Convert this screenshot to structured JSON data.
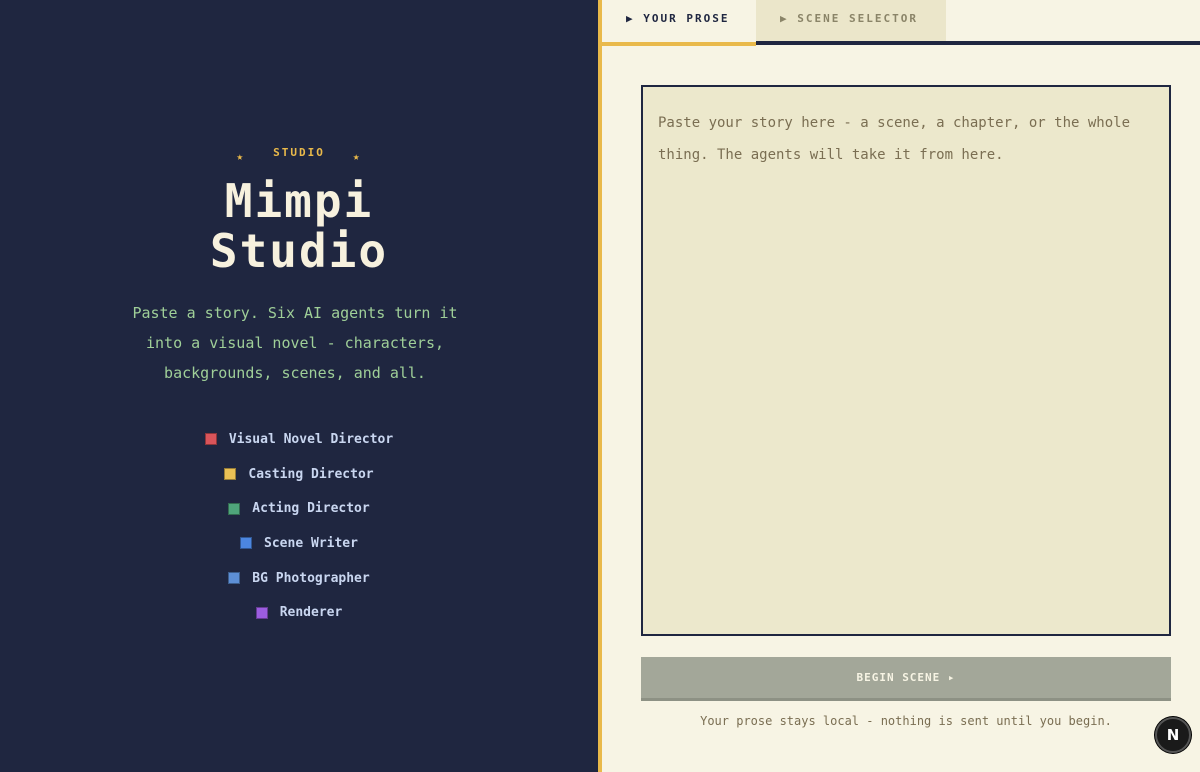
{
  "brand": {
    "eyebrow_star": "★",
    "eyebrow": "STUDIO",
    "title_line1": "Mimpi",
    "title_line2": "Studio",
    "tagline": "Paste a story. Six AI agents turn it into a visual novel - characters, backgrounds, scenes, and all."
  },
  "agents": [
    {
      "label": "Visual Novel Director",
      "color": "#d9545a"
    },
    {
      "label": "Casting Director",
      "color": "#e9c055"
    },
    {
      "label": "Acting Director",
      "color": "#4fa57b"
    },
    {
      "label": "Scene Writer",
      "color": "#4c86e0"
    },
    {
      "label": "BG Photographer",
      "color": "#5d8fd6"
    },
    {
      "label": "Renderer",
      "color": "#9b5de0"
    }
  ],
  "tabs": {
    "prose": "▶ YOUR PROSE",
    "scene": "▶ SCENE SELECTOR"
  },
  "story": {
    "value": "",
    "placeholder": "Paste your story here - a scene, a chapter, or the whole thing. The agents will take it from here."
  },
  "actions": {
    "begin": "BEGIN SCENE ▸"
  },
  "footer": {
    "note": "Your prose stays local - nothing is sent until you begin."
  },
  "badge": {
    "letter": "N"
  }
}
